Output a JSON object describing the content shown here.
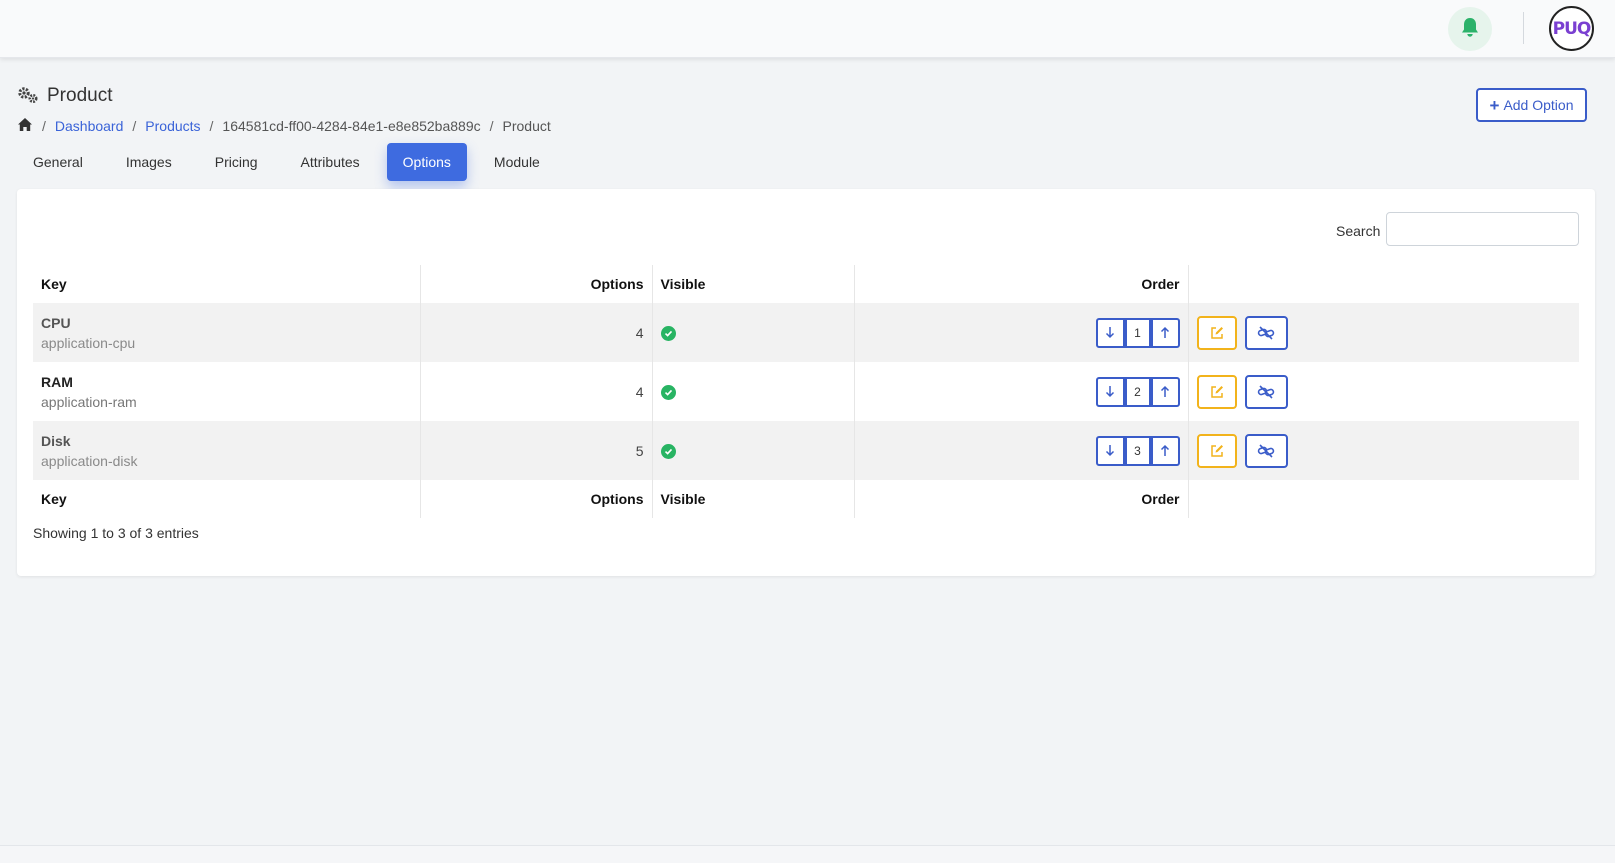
{
  "header": {
    "avatar_text": "PUQ"
  },
  "page": {
    "title": "Product",
    "breadcrumb": [
      {
        "label": "Dashboard"
      },
      {
        "label": "Products"
      },
      {
        "label": "164581cd-ff00-4284-84e1-e8e852ba889c"
      },
      {
        "label": "Product"
      }
    ],
    "separator": "/",
    "add_option_label": "Add Option"
  },
  "tabs": [
    {
      "label": "General",
      "active": false
    },
    {
      "label": "Images",
      "active": false
    },
    {
      "label": "Pricing",
      "active": false
    },
    {
      "label": "Attributes",
      "active": false
    },
    {
      "label": "Options",
      "active": true
    },
    {
      "label": "Module",
      "active": false
    }
  ],
  "search": {
    "label": "Search",
    "value": ""
  },
  "table": {
    "columns": [
      "Key",
      "Options",
      "Visible",
      "Order"
    ],
    "rows": [
      {
        "name": "CPU",
        "slug": "application-cpu",
        "options": "4",
        "order": "1"
      },
      {
        "name": "RAM",
        "slug": "application-ram",
        "options": "4",
        "order": "2"
      },
      {
        "name": "Disk",
        "slug": "application-disk",
        "options": "5",
        "order": "3"
      }
    ]
  },
  "footer": {
    "entries_text": "Showing 1 to 3 of 3 entries"
  },
  "colors": {
    "primary": "#3e6be0",
    "outline_blue": "#3a5cc9",
    "warning": "#f2b31b",
    "success": "#28b463",
    "bell_bg": "#e6f4ec"
  }
}
